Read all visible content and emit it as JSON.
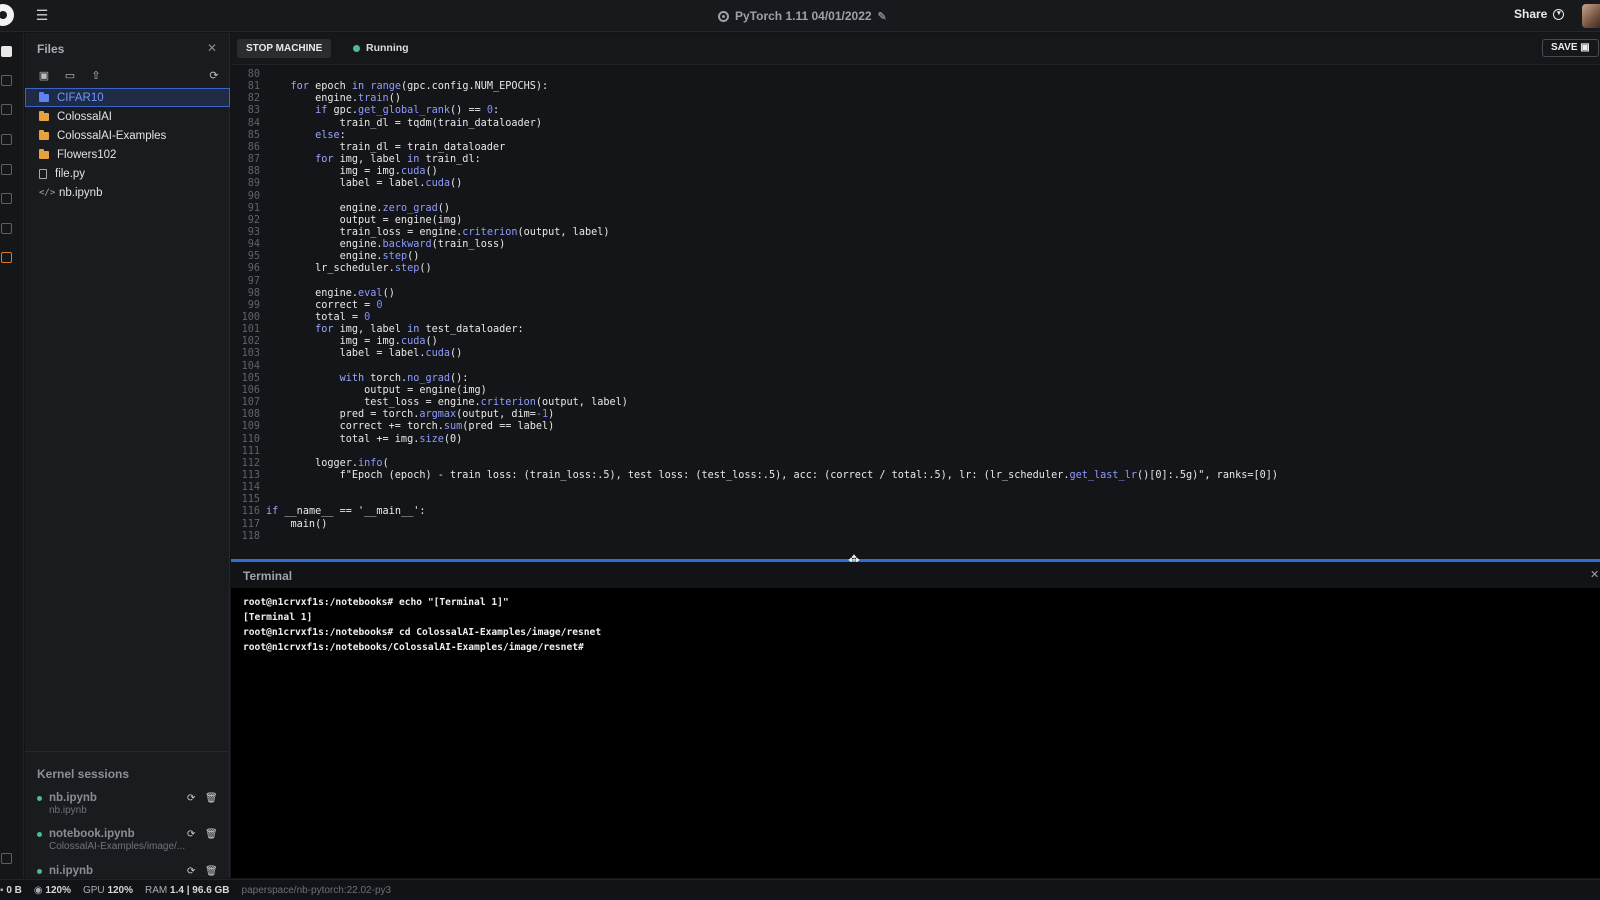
{
  "topbar": {
    "title": "PyTorch 1.11 04/01/2022",
    "share_label": "Share"
  },
  "files": {
    "header": "Files",
    "tree": [
      {
        "name": "CIFAR10",
        "type": "folder",
        "selected": true
      },
      {
        "name": "ColossalAI",
        "type": "folder"
      },
      {
        "name": "ColossalAI-Examples",
        "type": "folder"
      },
      {
        "name": "Flowers102",
        "type": "folder"
      },
      {
        "name": "file.py",
        "type": "file"
      },
      {
        "name": "nb.ipynb",
        "type": "notebook"
      }
    ]
  },
  "kernels": {
    "header": "Kernel sessions",
    "sessions": [
      {
        "name": "nb.ipynb",
        "path": "nb.ipynb"
      },
      {
        "name": "notebook.ipynb",
        "path": "ColossalAI-Examples/image/..."
      },
      {
        "name": "ni.ipynb",
        "path": ""
      }
    ]
  },
  "toolbar": {
    "stop_label": "STOP MACHINE",
    "status_label": "Running",
    "save_label": "SAVE"
  },
  "editor": {
    "lines": [
      {
        "n": "80",
        "t": ""
      },
      {
        "n": "81",
        "t": "    for epoch in range(gpc.config.NUM_EPOCHS):"
      },
      {
        "n": "82",
        "t": "        engine.train()"
      },
      {
        "n": "83",
        "t": "        if gpc.get_global_rank() == 0:"
      },
      {
        "n": "84",
        "t": "            train_dl = tqdm(train_dataloader)"
      },
      {
        "n": "85",
        "t": "        else:"
      },
      {
        "n": "86",
        "t": "            train_dl = train_dataloader"
      },
      {
        "n": "87",
        "t": "        for img, label in train_dl:"
      },
      {
        "n": "88",
        "t": "            img = img.cuda()"
      },
      {
        "n": "89",
        "t": "            label = label.cuda()"
      },
      {
        "n": "90",
        "t": ""
      },
      {
        "n": "91",
        "t": "            engine.zero_grad()"
      },
      {
        "n": "92",
        "t": "            output = engine(img)"
      },
      {
        "n": "93",
        "t": "            train_loss = engine.criterion(output, label)"
      },
      {
        "n": "94",
        "t": "            engine.backward(train_loss)"
      },
      {
        "n": "95",
        "t": "            engine.step()"
      },
      {
        "n": "96",
        "t": "        lr_scheduler.step()"
      },
      {
        "n": "97",
        "t": ""
      },
      {
        "n": "98",
        "t": "        engine.eval()"
      },
      {
        "n": "99",
        "t": "        correct = 0"
      },
      {
        "n": "100",
        "t": "        total = 0"
      },
      {
        "n": "101",
        "t": "        for img, label in test_dataloader:"
      },
      {
        "n": "102",
        "t": "            img = img.cuda()"
      },
      {
        "n": "103",
        "t": "            label = label.cuda()"
      },
      {
        "n": "104",
        "t": ""
      },
      {
        "n": "105",
        "t": "            with torch.no_grad():"
      },
      {
        "n": "106",
        "t": "                output = engine(img)"
      },
      {
        "n": "107",
        "t": "                test_loss = engine.criterion(output, label)"
      },
      {
        "n": "108",
        "t": "            pred = torch.argmax(output, dim=-1)"
      },
      {
        "n": "109",
        "t": "            correct += torch.sum(pred == label)"
      },
      {
        "n": "110",
        "t": "            total += img.size(0)"
      },
      {
        "n": "111",
        "t": ""
      },
      {
        "n": "112",
        "t": "        logger.info("
      },
      {
        "n": "113",
        "t": "            f\"Epoch (epoch) - train loss: (train_loss:.5), test loss: (test_loss:.5), acc: (correct / total:.5), lr: (lr_scheduler.get_last_lr()[0]:.5g)\", ranks=[0])"
      },
      {
        "n": "114",
        "t": ""
      },
      {
        "n": "115",
        "t": ""
      },
      {
        "n": "116",
        "t": "if __name__ == '__main__':"
      },
      {
        "n": "117",
        "t": "    main()"
      },
      {
        "n": "118",
        "t": ""
      }
    ]
  },
  "terminal": {
    "title": "Terminal",
    "lines": [
      "root@n1crvxf1s:/notebooks# echo \"[Terminal 1]\"",
      "[Terminal 1]",
      "root@n1crvxf1s:/notebooks# cd ColossalAI-Examples/image/resnet",
      "root@n1crvxf1s:/notebooks/ColossalAI-Examples/image/resnet#"
    ]
  },
  "statusbar": {
    "storage": "0 B",
    "cpu": "120%",
    "gpu_label": "GPU",
    "gpu": "120%",
    "ram_label": "RAM",
    "ram": "1.4 | 96.6 GB",
    "env": "paperspace/nb-pytorch:22.02-py3"
  }
}
